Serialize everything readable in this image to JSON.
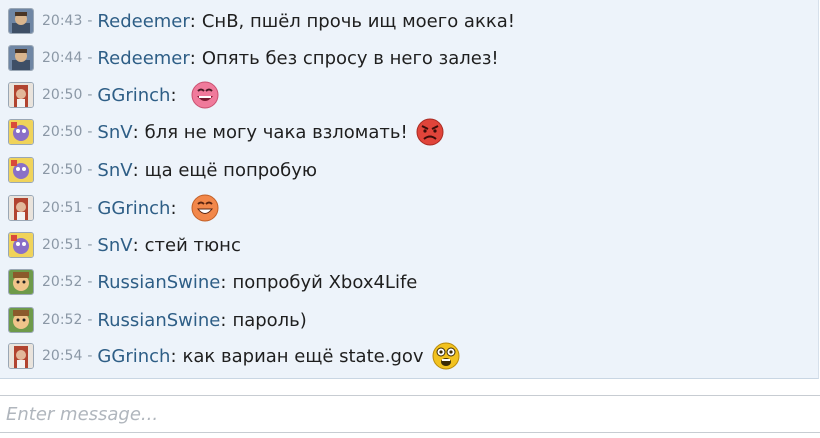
{
  "messages": [
    {
      "avatar": "redeemer-avatar",
      "time": "20:43",
      "user": "Redeemer",
      "text": "СнВ, пшёл прочь ищ моего акка!",
      "smiley": null
    },
    {
      "avatar": "redeemer-avatar",
      "time": "20:44",
      "user": "Redeemer",
      "text": "Опять без спросу в него залез!",
      "smiley": null
    },
    {
      "avatar": "ggrinch-avatar",
      "time": "20:50",
      "user": "GGrinch",
      "text": "",
      "smiley": "laughing-smiley-icon"
    },
    {
      "avatar": "snv-avatar",
      "time": "20:50",
      "user": "SnV",
      "text": "бля не могу чака взломать!",
      "smiley": "angry-smiley-icon"
    },
    {
      "avatar": "snv-avatar",
      "time": "20:50",
      "user": "SnV",
      "text": "ща ещё попробую",
      "smiley": null
    },
    {
      "avatar": "ggrinch-avatar",
      "time": "20:51",
      "user": "GGrinch",
      "text": "",
      "smiley": "grinning-smiley-icon"
    },
    {
      "avatar": "snv-avatar",
      "time": "20:51",
      "user": "SnV",
      "text": "стей тюнс",
      "smiley": null
    },
    {
      "avatar": "russianswine-avatar",
      "time": "20:52",
      "user": "RussianSwine",
      "text": "попробуй Xbox4Life",
      "smiley": null
    },
    {
      "avatar": "russianswine-avatar",
      "time": "20:52",
      "user": "RussianSwine",
      "text": "пароль)",
      "smiley": null
    },
    {
      "avatar": "ggrinch-avatar",
      "time": "20:54",
      "user": "GGrinch",
      "text": "как вариан ещё state.gov",
      "smiley": "shocked-smiley-icon"
    }
  ],
  "separator": "-",
  "colon": ":",
  "input": {
    "placeholder": "Enter message...",
    "value": ""
  },
  "colors": {
    "username": "#2e5e86",
    "timestamp": "#8b98a6",
    "log_background": "#edf3fa"
  }
}
